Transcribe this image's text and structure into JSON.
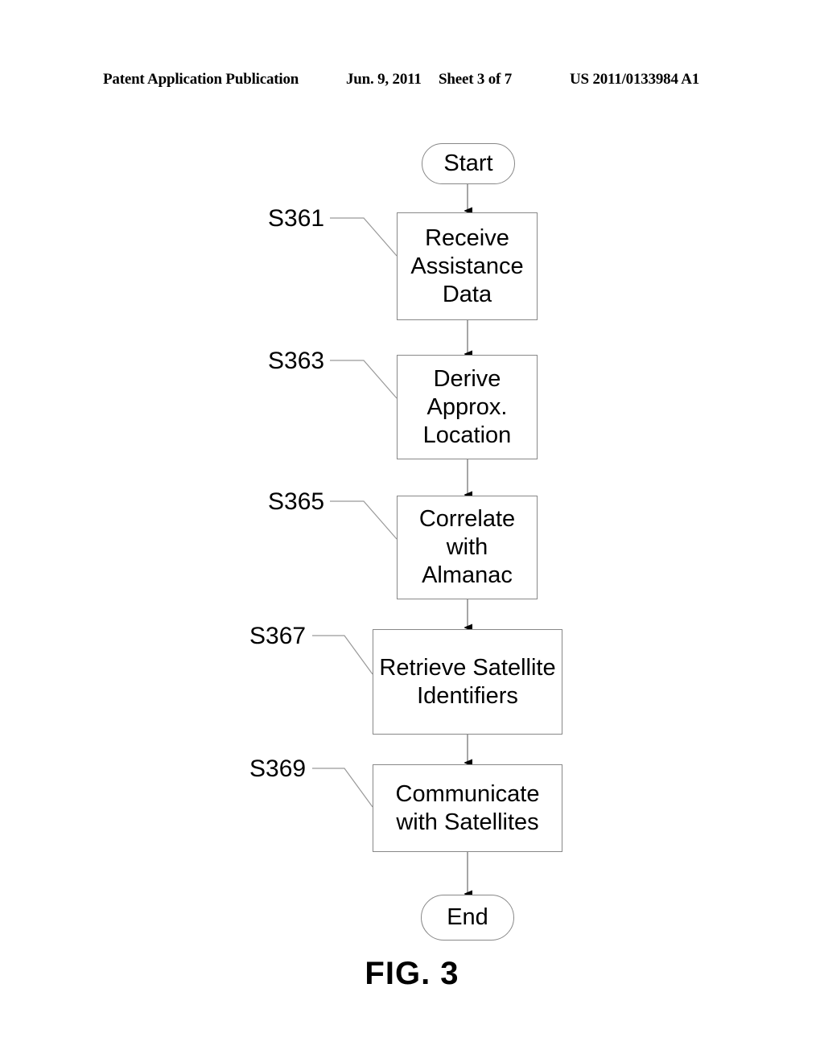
{
  "header": {
    "title": "Patent Application Publication",
    "date": "Jun. 9, 2011",
    "sheet": "Sheet 3 of 7",
    "publication_number": "US 2011/0133984 A1"
  },
  "figure": {
    "caption": "FIG. 3",
    "type": "flowchart",
    "nodes": [
      {
        "id": "start",
        "shape": "terminal",
        "text": "Start"
      },
      {
        "id": "s361",
        "shape": "process",
        "text": "Receive\nAssistance\nData"
      },
      {
        "id": "s363",
        "shape": "process",
        "text": "Derive\nApprox.\nLocation"
      },
      {
        "id": "s365",
        "shape": "process",
        "text": "Correlate\nwith\nAlmanac"
      },
      {
        "id": "s367",
        "shape": "process",
        "text": "Retrieve Satellite\nIdentifiers"
      },
      {
        "id": "s369",
        "shape": "process",
        "text": "Communicate\nwith Satellites"
      },
      {
        "id": "end",
        "shape": "terminal",
        "text": "End"
      }
    ],
    "step_labels": [
      {
        "id": "s361",
        "text": "S361"
      },
      {
        "id": "s363",
        "text": "S363"
      },
      {
        "id": "s365",
        "text": "S365"
      },
      {
        "id": "s367",
        "text": "S367"
      },
      {
        "id": "s369",
        "text": "S369"
      }
    ],
    "edges": [
      {
        "from": "start",
        "to": "s361"
      },
      {
        "from": "s361",
        "to": "s363"
      },
      {
        "from": "s363",
        "to": "s365"
      },
      {
        "from": "s365",
        "to": "s367"
      },
      {
        "from": "s367",
        "to": "s369"
      },
      {
        "from": "s369",
        "to": "end"
      }
    ],
    "colors": {
      "stroke": "#888888",
      "arrow": "#000000",
      "text": "#000000",
      "background": "#ffffff"
    }
  }
}
